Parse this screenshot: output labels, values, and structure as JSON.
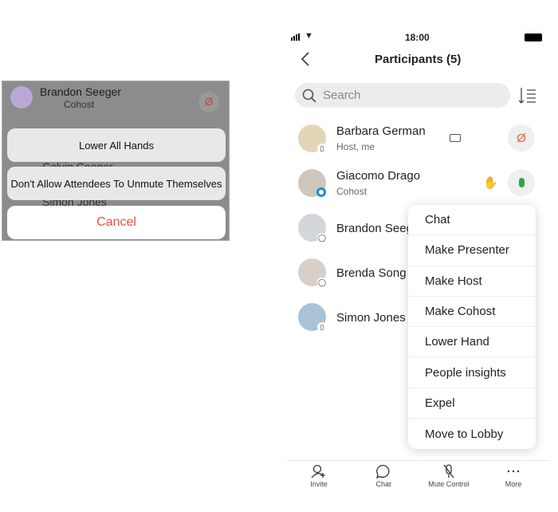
{
  "left_sheet": {
    "header_name": "Brandon Seeger",
    "header_role": "Cohost",
    "hidden_rows": [
      "Calvin Cooper",
      "Simon Jones"
    ],
    "actions": [
      "Lower All Hands",
      "Don't Allow Attendees To Unmute Themselves"
    ],
    "cancel_label": "Cancel",
    "cancel_color": "#f0503c"
  },
  "status_bar": {
    "time": "18:00"
  },
  "header": {
    "title": "Participants (5)"
  },
  "search": {
    "placeholder": "Search"
  },
  "participants": [
    {
      "name": "Barbara German",
      "role": "Host, me",
      "mic": "muted"
    },
    {
      "name": "Giacomo Drago",
      "role": "Cohost",
      "mic": "unmuted",
      "hand_raised": true
    },
    {
      "name": "Brandon Seeger",
      "role": ""
    },
    {
      "name": "Brenda Song",
      "role": ""
    },
    {
      "name": "Simon Jones",
      "role": ""
    }
  ],
  "context_menu": [
    "Chat",
    "Make Presenter",
    "Make Host",
    "Make Cohost",
    "Lower Hand",
    "People insights",
    "Expel",
    "Move to Lobby"
  ],
  "bottom_tabs": [
    {
      "label": "Invite",
      "icon": "add-person-icon"
    },
    {
      "label": "Chat",
      "icon": "chat-bubble-icon"
    },
    {
      "label": "Mute Control",
      "icon": "mic-off-icon"
    },
    {
      "label": "More",
      "icon": "ellipsis-icon"
    }
  ],
  "colors": {
    "muted": "#e8604c",
    "unmuted": "#2ea44f"
  }
}
